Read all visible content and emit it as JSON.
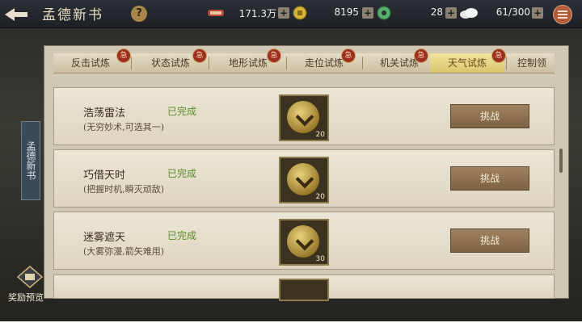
{
  "header": {
    "title": "孟德新书",
    "help_label": "?"
  },
  "resources": [
    {
      "icon": "scroll-icon",
      "value": "171.3万"
    },
    {
      "icon": "gold-coin-icon",
      "value": "8195"
    },
    {
      "icon": "jade-icon",
      "value": "28"
    },
    {
      "icon": "cloud-icon",
      "value": "61/300"
    }
  ],
  "plus_label": "+",
  "tabs": [
    {
      "label": "反击试炼",
      "badge": "急"
    },
    {
      "label": "状态试炼",
      "badge": "急"
    },
    {
      "label": "地形试炼",
      "badge": "急"
    },
    {
      "label": "走位试炼",
      "badge": "急"
    },
    {
      "label": "机关试炼",
      "badge": "急"
    },
    {
      "label": "天气试炼",
      "badge": "急",
      "active": true
    },
    {
      "label": "控制领",
      "badge": ""
    }
  ],
  "side_tab_label": "孟德新书",
  "rows": [
    {
      "name": "浩荡雷法",
      "status": "已完成",
      "desc": "(无穷妙术,可选其一)",
      "reward_count": "20",
      "button": "挑战"
    },
    {
      "name": "巧借天时",
      "status": "已完成",
      "desc": "(把握时机,瞬灭顽敌)",
      "reward_count": "20",
      "button": "挑战"
    },
    {
      "name": "迷雾遮天",
      "status": "已完成",
      "desc": "(大雾弥漫,箭矢难用)",
      "reward_count": "30",
      "button": "挑战"
    }
  ],
  "reward_preview_label": "奖励预览"
}
